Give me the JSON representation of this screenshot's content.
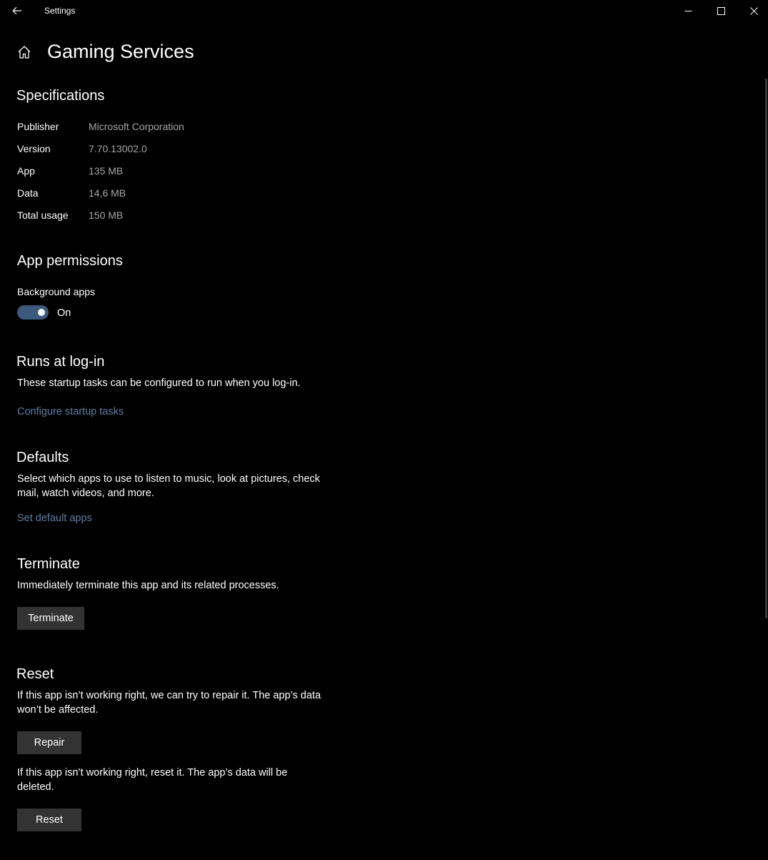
{
  "window": {
    "title": "Settings"
  },
  "header": {
    "title": "Gaming Services"
  },
  "specifications": {
    "heading": "Specifications",
    "rows": [
      {
        "label": "Publisher",
        "value": "Microsoft Corporation"
      },
      {
        "label": "Version",
        "value": "7.70.13002.0"
      },
      {
        "label": "App",
        "value": "135 MB"
      },
      {
        "label": "Data",
        "value": "14,6 MB"
      },
      {
        "label": "Total usage",
        "value": "150 MB"
      }
    ]
  },
  "permissions": {
    "heading": "App permissions",
    "background_label": "Background apps",
    "toggle_state": "On",
    "toggle_on": true
  },
  "runs_at_login": {
    "heading": "Runs at log-in",
    "description": "These startup tasks can be configured to run when you log-in.",
    "link": "Configure startup tasks"
  },
  "defaults": {
    "heading": "Defaults",
    "description": "Select which apps to use to listen to music, look at pictures, check mail, watch videos, and more.",
    "link": "Set default apps"
  },
  "terminate": {
    "heading": "Terminate",
    "description": "Immediately terminate this app and its related processes.",
    "button": "Terminate"
  },
  "reset": {
    "heading": "Reset",
    "repair_description": "If this app isn’t working right, we can try to repair it. The app’s data won’t be affected.",
    "repair_button": "Repair",
    "reset_description": "If this app isn’t working right, reset it. The app’s data will be deleted.",
    "reset_button": "Reset"
  },
  "colors": {
    "background": "#000000",
    "accent_toggle": "#3b5a7e",
    "link": "#5e7ea6",
    "secondary_text": "#a6a6a6",
    "button": "#333333"
  }
}
